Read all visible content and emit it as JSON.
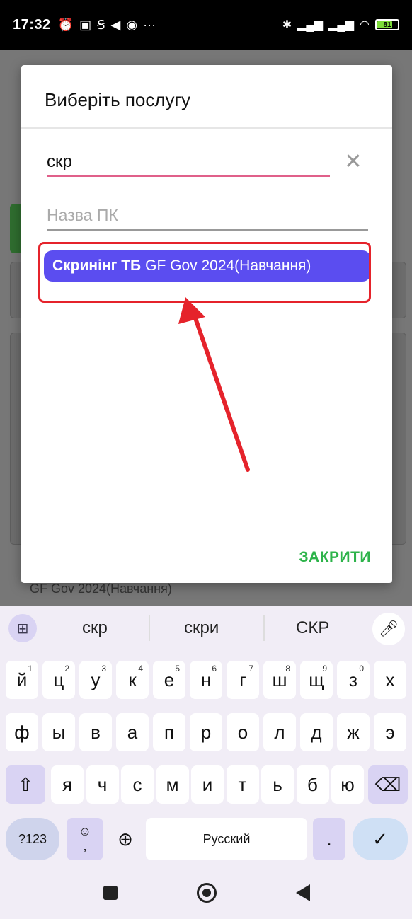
{
  "status_bar": {
    "time": "17:32",
    "left_icons": [
      "alarm-icon",
      "nfc-icon",
      "s-icon",
      "telegram-icon",
      "record-icon",
      "more-icon"
    ],
    "right_icons": [
      "bluetooth-icon",
      "signal-icon",
      "signal-icon",
      "wifi-icon",
      "battery-icon"
    ],
    "battery_level": "81"
  },
  "background": {
    "visible_text": "GF Gov 2024(Навчання)"
  },
  "dialog": {
    "title": "Виберіть послугу",
    "search_value": "скр",
    "name_placeholder": "Назва ПК",
    "result": {
      "bold": "Скринінг ТБ",
      "rest": "GF Gov 2024(Навчання)"
    },
    "close_label": "ЗАКРИТИ"
  },
  "keyboard": {
    "suggestions": [
      "скр",
      "скри",
      "СКР"
    ],
    "row1": [
      {
        "k": "й",
        "n": "1"
      },
      {
        "k": "ц",
        "n": "2"
      },
      {
        "k": "у",
        "n": "3"
      },
      {
        "k": "к",
        "n": "4"
      },
      {
        "k": "е",
        "n": "5"
      },
      {
        "k": "н",
        "n": "6"
      },
      {
        "k": "г",
        "n": "7"
      },
      {
        "k": "ш",
        "n": "8"
      },
      {
        "k": "щ",
        "n": "9"
      },
      {
        "k": "з",
        "n": "0"
      },
      {
        "k": "х",
        "n": ""
      }
    ],
    "row2": [
      "ф",
      "ы",
      "в",
      "а",
      "п",
      "р",
      "о",
      "л",
      "д",
      "ж",
      "э"
    ],
    "row3": [
      "я",
      "ч",
      "с",
      "м",
      "и",
      "т",
      "ь",
      "б",
      "ю"
    ],
    "num_label": "?123",
    "comma_label": ",",
    "space_label": "Русский",
    "period_label": ".",
    "accent_color": "#5b4df0",
    "highlight_color": "#e5232b",
    "close_color": "#2db34a"
  }
}
